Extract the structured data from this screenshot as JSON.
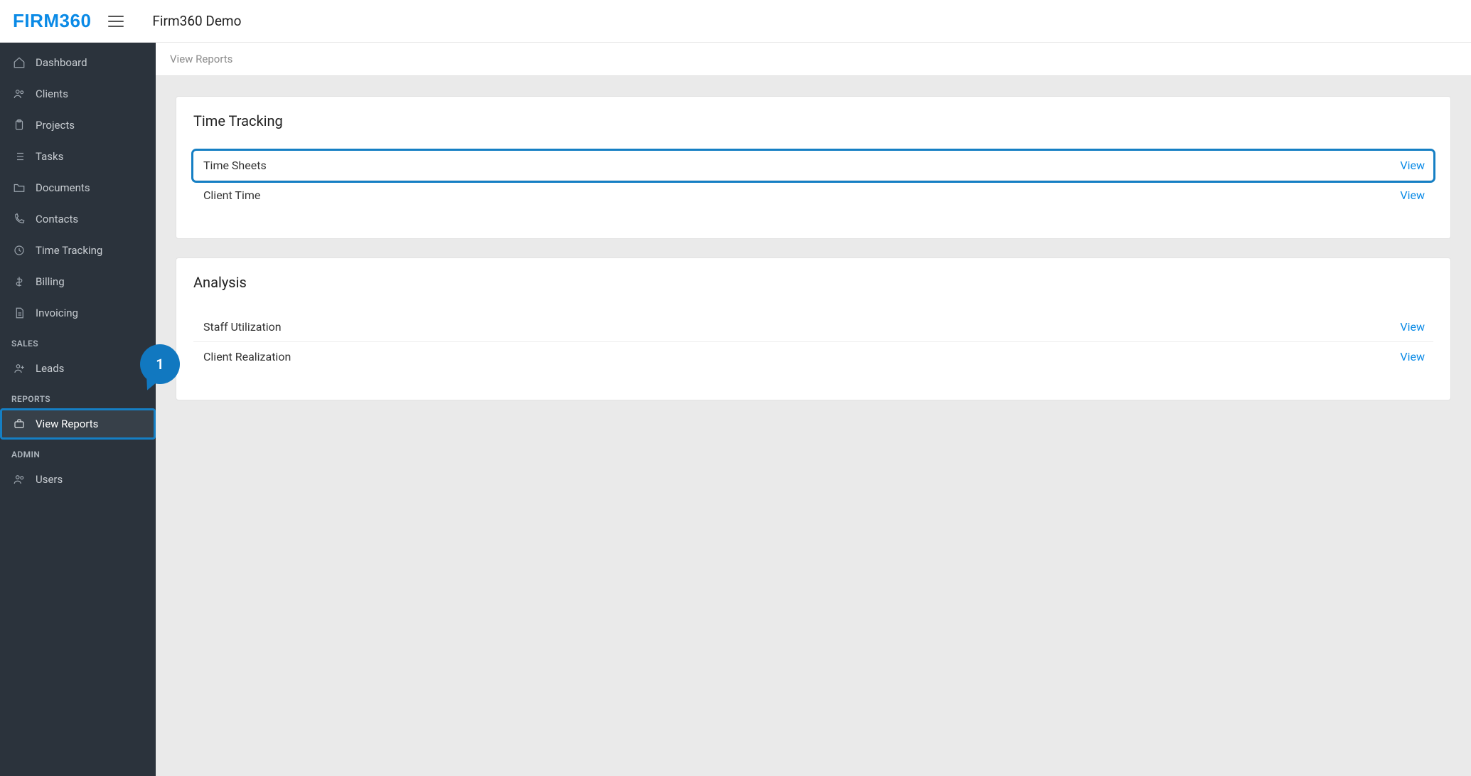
{
  "header": {
    "logo_text": "FIRM360",
    "page_title": "Firm360 Demo"
  },
  "breadcrumb": "View Reports",
  "sidebar": {
    "main_items": [
      {
        "id": "dashboard",
        "label": "Dashboard",
        "icon": "home-icon"
      },
      {
        "id": "clients",
        "label": "Clients",
        "icon": "users-icon"
      },
      {
        "id": "projects",
        "label": "Projects",
        "icon": "clipboard-icon"
      },
      {
        "id": "tasks",
        "label": "Tasks",
        "icon": "list-icon"
      },
      {
        "id": "documents",
        "label": "Documents",
        "icon": "folder-icon"
      },
      {
        "id": "contacts",
        "label": "Contacts",
        "icon": "phone-icon"
      },
      {
        "id": "time-tracking",
        "label": "Time Tracking",
        "icon": "clock-icon"
      },
      {
        "id": "billing",
        "label": "Billing",
        "icon": "dollar-icon"
      },
      {
        "id": "invoicing",
        "label": "Invoicing",
        "icon": "document-icon"
      }
    ],
    "sales_label": "SALES",
    "sales_items": [
      {
        "id": "leads",
        "label": "Leads",
        "icon": "user-plus-icon"
      }
    ],
    "reports_label": "REPORTS",
    "reports_items": [
      {
        "id": "view-reports",
        "label": "View Reports",
        "icon": "briefcase-icon",
        "active": true
      }
    ],
    "admin_label": "ADMIN",
    "admin_items": [
      {
        "id": "users",
        "label": "Users",
        "icon": "users-icon"
      }
    ]
  },
  "callout_number": "1",
  "cards": [
    {
      "title": "Time Tracking",
      "rows": [
        {
          "label": "Time Sheets",
          "action": "View",
          "highlight": true
        },
        {
          "label": "Client Time",
          "action": "View",
          "highlight": false
        }
      ]
    },
    {
      "title": "Analysis",
      "rows": [
        {
          "label": "Staff Utilization",
          "action": "View",
          "highlight": false
        },
        {
          "label": "Client Realization",
          "action": "View",
          "highlight": false
        }
      ]
    }
  ],
  "colors": {
    "accent": "#0a8ae6",
    "sidebar_bg": "#2b333c",
    "highlight_border": "#157fc4",
    "content_bg": "#eaeaea"
  }
}
